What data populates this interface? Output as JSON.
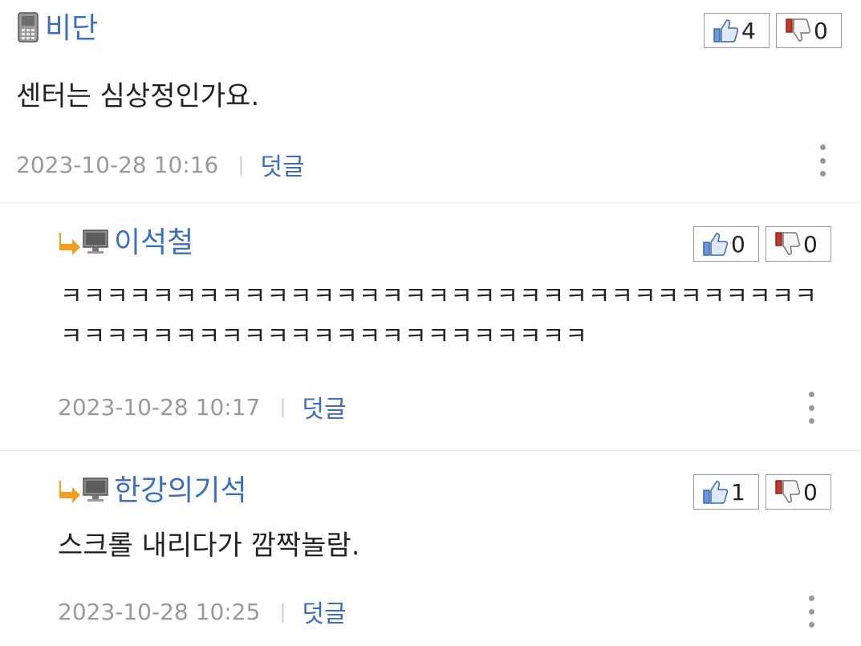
{
  "comments": [
    {
      "author": "비단",
      "device_icon": "mobile-phone-icon",
      "is_reply": false,
      "text": "센터는 심상정인가요.",
      "datetime": "2023-10-28 10:16",
      "reply_label": "덧글",
      "likes": "4",
      "dislikes": "0"
    },
    {
      "author": "이석철",
      "device_icon": "desktop-monitor-icon",
      "is_reply": true,
      "text": "ㅋㅋㅋㅋㅋㅋㅋㅋㅋㅋㅋㅋㅋㅋㅋㅋㅋㅋㅋㅋㅋㅋㅋㅋㅋㅋㅋㅋㅋㅋㅋㅋㅋㅋㅋㅋㅋㅋㅋㅋㅋㅋㅋㅋㅋㅋㅋㅋㅋㅋㅋㅋㅋㅋㅋㅋ",
      "datetime": "2023-10-28 10:17",
      "reply_label": "덧글",
      "likes": "0",
      "dislikes": "0"
    },
    {
      "author": "한강의기석",
      "device_icon": "desktop-monitor-icon",
      "is_reply": true,
      "text": "스크롤 내리다가 깜짝놀람.",
      "datetime": "2023-10-28 10:25",
      "reply_label": "덧글",
      "likes": "1",
      "dislikes": "0"
    }
  ],
  "separator": "|",
  "colors": {
    "author": "#3b6fc4",
    "meta": "#999999",
    "reply_arrow": "#f0a020",
    "thumb_up": "#4a7fd0",
    "thumb_down": "#c0392b"
  }
}
